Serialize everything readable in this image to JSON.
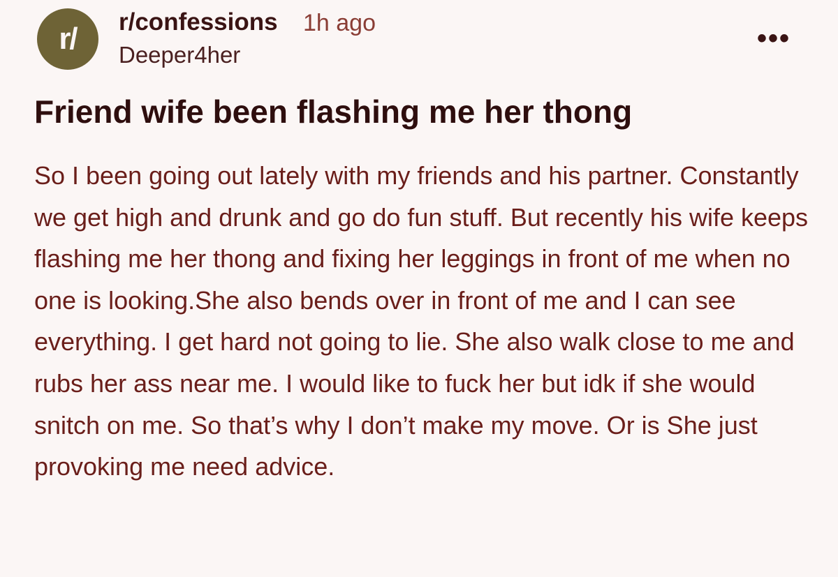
{
  "post": {
    "avatar_text": "r/",
    "subreddit": "r/confessions",
    "time": "1h ago",
    "author": "Deeper4her",
    "more_icon": "more-horizontal-icon",
    "more_glyph": "•••",
    "title": "Friend wife been flashing me her thong",
    "body": "So I been going out lately with my friends and his partner. Constantly we get high and drunk and go do fun stuff. But recently his wife keeps flashing me her thong and fixing her leggings in front of me when no one is looking.She also bends over in front of me and I can see everything. I get hard not going to lie. She also walk close to me and rubs her ass near me. I would like to fuck her but idk if she would snitch on me. So that’s why I don’t make my move. Or is She just provoking me need advice."
  },
  "colors": {
    "background": "#fbf6f5",
    "avatar": "#6e6336",
    "text": "#3a1414",
    "body_text": "#6a1e1a",
    "meta_text": "#8a3d35"
  }
}
